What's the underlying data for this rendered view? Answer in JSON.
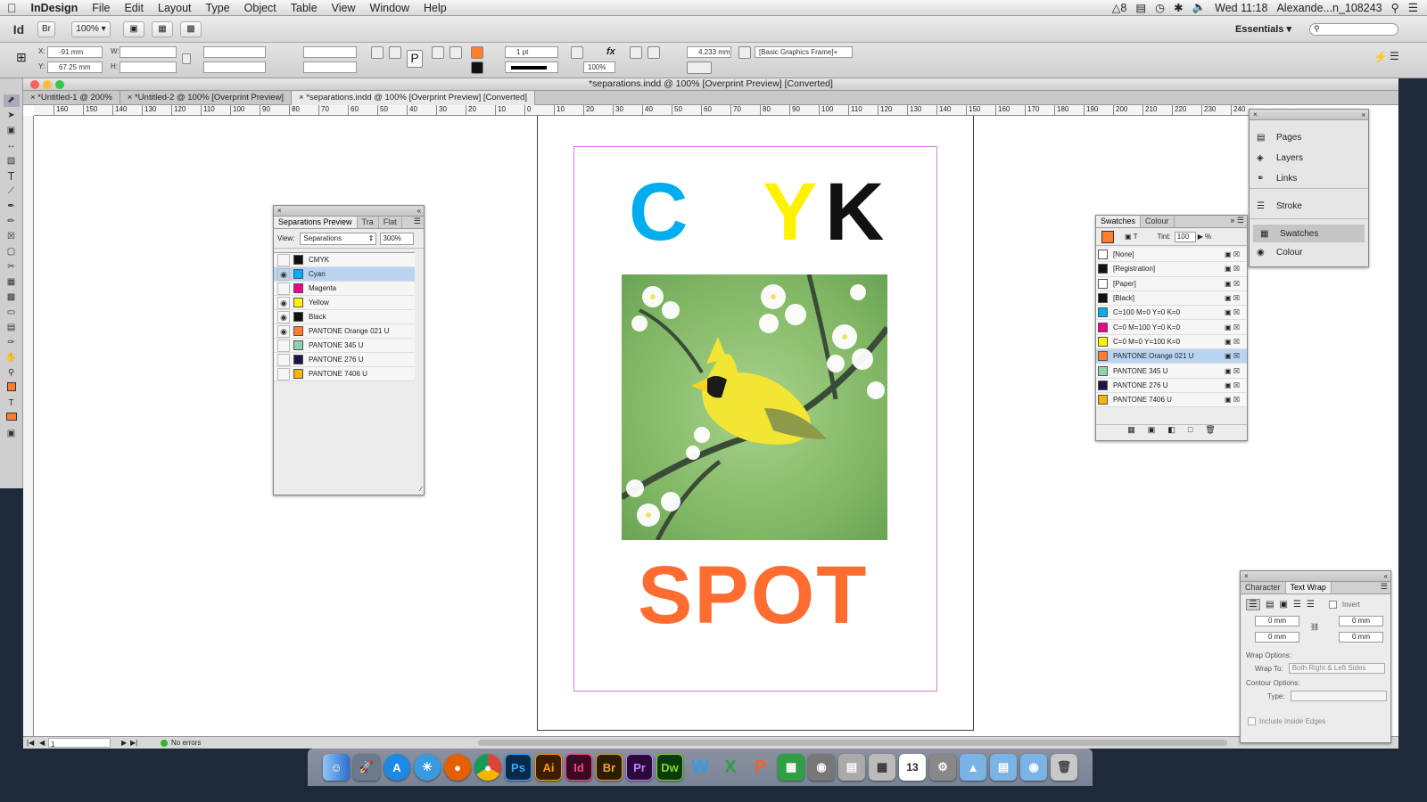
{
  "menubar": {
    "app": "InDesign",
    "items": [
      "File",
      "Edit",
      "Layout",
      "Type",
      "Object",
      "Table",
      "View",
      "Window",
      "Help"
    ],
    "status_num": "8",
    "clock": "Wed 11:18",
    "user": "Alexande...n_108243"
  },
  "control": {
    "app_badge": "Id",
    "bridge_badge": "Br",
    "zoom": "100%",
    "workspace": "Essentials",
    "x_label": "X:",
    "y_label": "Y:",
    "w_label": "W:",
    "h_label": "H:",
    "x_value": "-91 mm",
    "y_value": "67.25 mm",
    "stroke_weight": "1 pt",
    "opacity": "100%",
    "dimension": "4.233 mm",
    "object_style": "[Basic Graphics Frame]+"
  },
  "document": {
    "window_title": "*separations.indd @ 100% [Overprint Preview] [Converted]",
    "tabs": [
      "*Untitled-1 @ 200%",
      "*Untitled-2 @ 100% [Overprint Preview]",
      "*separations.indd @ 100% [Overprint Preview] [Converted]"
    ],
    "ruler_ticks": [
      "160",
      "150",
      "140",
      "130",
      "120",
      "110",
      "100",
      "90",
      "80",
      "70",
      "60",
      "50",
      "40",
      "30",
      "20",
      "10",
      "0",
      "10",
      "20",
      "30",
      "40",
      "50",
      "60",
      "70",
      "80",
      "90",
      "100",
      "110",
      "120",
      "130",
      "140",
      "150",
      "160",
      "170",
      "180",
      "190",
      "200",
      "210",
      "220",
      "230",
      "240"
    ],
    "heading_c": "C",
    "heading_y": "Y",
    "heading_k": "K",
    "spot_text": "SPOT",
    "page_number": "1",
    "errors": "No errors"
  },
  "colors": {
    "cyan": "#00aeef",
    "yellow": "#fff200",
    "black": "#111111",
    "orange": "#ff6c2f",
    "margin_guide": "#d27ce0"
  },
  "separations": {
    "title": "Separations Preview",
    "tab2": "Tra",
    "tab3": "Flat",
    "view_label": "View:",
    "view_value": "Separations",
    "zoom": "300%",
    "rows": [
      {
        "name": "CMYK",
        "visible": false,
        "color": "#111"
      },
      {
        "name": "Cyan",
        "visible": true,
        "color": "#00aeef",
        "selected": true
      },
      {
        "name": "Magenta",
        "visible": false,
        "color": "#ec008c"
      },
      {
        "name": "Yellow",
        "visible": true,
        "color": "#fff200"
      },
      {
        "name": "Black",
        "visible": true,
        "color": "#111111"
      },
      {
        "name": "PANTONE Orange 021 U",
        "visible": true,
        "color": "#ff7d2f"
      },
      {
        "name": "PANTONE 345 U",
        "visible": false,
        "color": "#8ed3b0"
      },
      {
        "name": "PANTONE 276 U",
        "visible": false,
        "color": "#1c1444"
      },
      {
        "name": "PANTONE 7406 U",
        "visible": false,
        "color": "#f2b705"
      }
    ]
  },
  "dockpanel": {
    "items": [
      "Pages",
      "Layers",
      "Links",
      "Stroke",
      "Swatches",
      "Colour"
    ]
  },
  "swatches": {
    "tab1": "Swatches",
    "tab2": "Colour",
    "tint_label": "Tint:",
    "tint_value": "100",
    "percent": "%",
    "rows": [
      {
        "name": "[None]",
        "color": "#ffffff"
      },
      {
        "name": "[Registration]",
        "color": "#111111"
      },
      {
        "name": "[Paper]",
        "color": "#ffffff"
      },
      {
        "name": "[Black]",
        "color": "#111111"
      },
      {
        "name": "C=100 M=0 Y=0 K=0",
        "color": "#00aeef"
      },
      {
        "name": "C=0 M=100 Y=0 K=0",
        "color": "#ec008c"
      },
      {
        "name": "C=0 M=0 Y=100 K=0",
        "color": "#fff200"
      },
      {
        "name": "PANTONE Orange 021 U",
        "color": "#ff7d2f",
        "selected": true
      },
      {
        "name": "PANTONE 345 U",
        "color": "#8ed3b0"
      },
      {
        "name": "PANTONE 276 U",
        "color": "#1c1444"
      },
      {
        "name": "PANTONE 7406 U",
        "color": "#f2b705"
      }
    ]
  },
  "textwrap": {
    "tab1": "Character",
    "tab2": "Text Wrap",
    "invert": "Invert",
    "top": "0 mm",
    "bottom": "0 mm",
    "left": "0 mm",
    "right": "0 mm",
    "wrap_options": "Wrap Options:",
    "wrap_to_label": "Wrap To:",
    "wrap_to": "Both Right & Left Sides",
    "contour_options": "Contour Options:",
    "type_label": "Type:",
    "include_edges": "Include Inside Edges"
  },
  "dock": {
    "apps": [
      "Ps",
      "Ai",
      "Id",
      "Br",
      "Pr",
      "Dw",
      "W",
      "X",
      "P",
      "13"
    ]
  }
}
